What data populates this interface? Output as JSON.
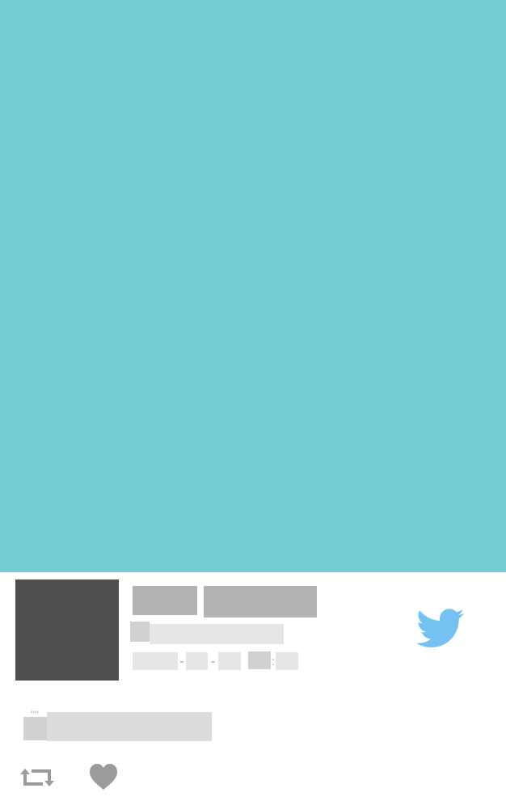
{
  "colors": {
    "hero_background": "#74cdd5",
    "avatar": "#4f4f4f",
    "name_placeholder": "#b3b3b3",
    "meta_placeholder_dark": "#d1d1d1",
    "meta_placeholder_light": "#e6e6e6",
    "tweet_placeholder": "#dcdcdc",
    "twitter_brand": "#74c2f2",
    "action_icon": "#9b9b9b"
  },
  "tweet": {
    "date_separator_1": "-",
    "date_separator_2": "-",
    "time_separator": ":",
    "quote_mark": "\"\""
  },
  "icons": {
    "brand": "twitter-bird-icon",
    "retweet": "retweet-icon",
    "like": "heart-icon"
  }
}
